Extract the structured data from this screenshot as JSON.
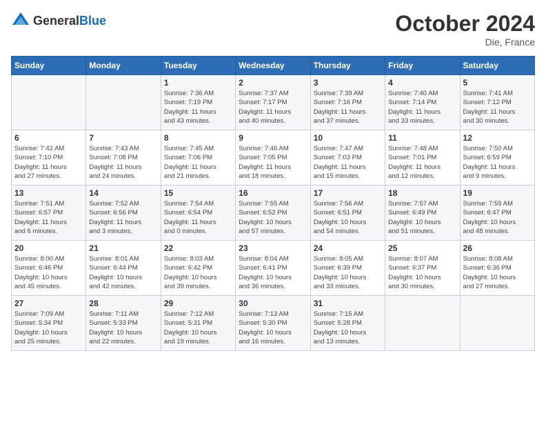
{
  "logo": {
    "general": "General",
    "blue": "Blue"
  },
  "title": "October 2024",
  "location": "Die, France",
  "days_header": [
    "Sunday",
    "Monday",
    "Tuesday",
    "Wednesday",
    "Thursday",
    "Friday",
    "Saturday"
  ],
  "weeks": [
    [
      {
        "day": "",
        "info": ""
      },
      {
        "day": "",
        "info": ""
      },
      {
        "day": "1",
        "info": "Sunrise: 7:36 AM\nSunset: 7:19 PM\nDaylight: 11 hours\nand 43 minutes."
      },
      {
        "day": "2",
        "info": "Sunrise: 7:37 AM\nSunset: 7:17 PM\nDaylight: 11 hours\nand 40 minutes."
      },
      {
        "day": "3",
        "info": "Sunrise: 7:39 AM\nSunset: 7:16 PM\nDaylight: 11 hours\nand 37 minutes."
      },
      {
        "day": "4",
        "info": "Sunrise: 7:40 AM\nSunset: 7:14 PM\nDaylight: 11 hours\nand 33 minutes."
      },
      {
        "day": "5",
        "info": "Sunrise: 7:41 AM\nSunset: 7:12 PM\nDaylight: 11 hours\nand 30 minutes."
      }
    ],
    [
      {
        "day": "6",
        "info": "Sunrise: 7:42 AM\nSunset: 7:10 PM\nDaylight: 11 hours\nand 27 minutes."
      },
      {
        "day": "7",
        "info": "Sunrise: 7:43 AM\nSunset: 7:08 PM\nDaylight: 11 hours\nand 24 minutes."
      },
      {
        "day": "8",
        "info": "Sunrise: 7:45 AM\nSunset: 7:06 PM\nDaylight: 11 hours\nand 21 minutes."
      },
      {
        "day": "9",
        "info": "Sunrise: 7:46 AM\nSunset: 7:05 PM\nDaylight: 11 hours\nand 18 minutes."
      },
      {
        "day": "10",
        "info": "Sunrise: 7:47 AM\nSunset: 7:03 PM\nDaylight: 11 hours\nand 15 minutes."
      },
      {
        "day": "11",
        "info": "Sunrise: 7:48 AM\nSunset: 7:01 PM\nDaylight: 11 hours\nand 12 minutes."
      },
      {
        "day": "12",
        "info": "Sunrise: 7:50 AM\nSunset: 6:59 PM\nDaylight: 11 hours\nand 9 minutes."
      }
    ],
    [
      {
        "day": "13",
        "info": "Sunrise: 7:51 AM\nSunset: 6:57 PM\nDaylight: 11 hours\nand 6 minutes."
      },
      {
        "day": "14",
        "info": "Sunrise: 7:52 AM\nSunset: 6:56 PM\nDaylight: 11 hours\nand 3 minutes."
      },
      {
        "day": "15",
        "info": "Sunrise: 7:54 AM\nSunset: 6:54 PM\nDaylight: 11 hours\nand 0 minutes."
      },
      {
        "day": "16",
        "info": "Sunrise: 7:55 AM\nSunset: 6:52 PM\nDaylight: 10 hours\nand 57 minutes."
      },
      {
        "day": "17",
        "info": "Sunrise: 7:56 AM\nSunset: 6:51 PM\nDaylight: 10 hours\nand 54 minutes."
      },
      {
        "day": "18",
        "info": "Sunrise: 7:57 AM\nSunset: 6:49 PM\nDaylight: 10 hours\nand 51 minutes."
      },
      {
        "day": "19",
        "info": "Sunrise: 7:59 AM\nSunset: 6:47 PM\nDaylight: 10 hours\nand 48 minutes."
      }
    ],
    [
      {
        "day": "20",
        "info": "Sunrise: 8:00 AM\nSunset: 6:46 PM\nDaylight: 10 hours\nand 45 minutes."
      },
      {
        "day": "21",
        "info": "Sunrise: 8:01 AM\nSunset: 6:44 PM\nDaylight: 10 hours\nand 42 minutes."
      },
      {
        "day": "22",
        "info": "Sunrise: 8:03 AM\nSunset: 6:42 PM\nDaylight: 10 hours\nand 39 minutes."
      },
      {
        "day": "23",
        "info": "Sunrise: 8:04 AM\nSunset: 6:41 PM\nDaylight: 10 hours\nand 36 minutes."
      },
      {
        "day": "24",
        "info": "Sunrise: 8:05 AM\nSunset: 6:39 PM\nDaylight: 10 hours\nand 33 minutes."
      },
      {
        "day": "25",
        "info": "Sunrise: 8:07 AM\nSunset: 6:37 PM\nDaylight: 10 hours\nand 30 minutes."
      },
      {
        "day": "26",
        "info": "Sunrise: 8:08 AM\nSunset: 6:36 PM\nDaylight: 10 hours\nand 27 minutes."
      }
    ],
    [
      {
        "day": "27",
        "info": "Sunrise: 7:09 AM\nSunset: 5:34 PM\nDaylight: 10 hours\nand 25 minutes."
      },
      {
        "day": "28",
        "info": "Sunrise: 7:11 AM\nSunset: 5:33 PM\nDaylight: 10 hours\nand 22 minutes."
      },
      {
        "day": "29",
        "info": "Sunrise: 7:12 AM\nSunset: 5:31 PM\nDaylight: 10 hours\nand 19 minutes."
      },
      {
        "day": "30",
        "info": "Sunrise: 7:13 AM\nSunset: 5:30 PM\nDaylight: 10 hours\nand 16 minutes."
      },
      {
        "day": "31",
        "info": "Sunrise: 7:15 AM\nSunset: 5:28 PM\nDaylight: 10 hours\nand 13 minutes."
      },
      {
        "day": "",
        "info": ""
      },
      {
        "day": "",
        "info": ""
      }
    ]
  ]
}
